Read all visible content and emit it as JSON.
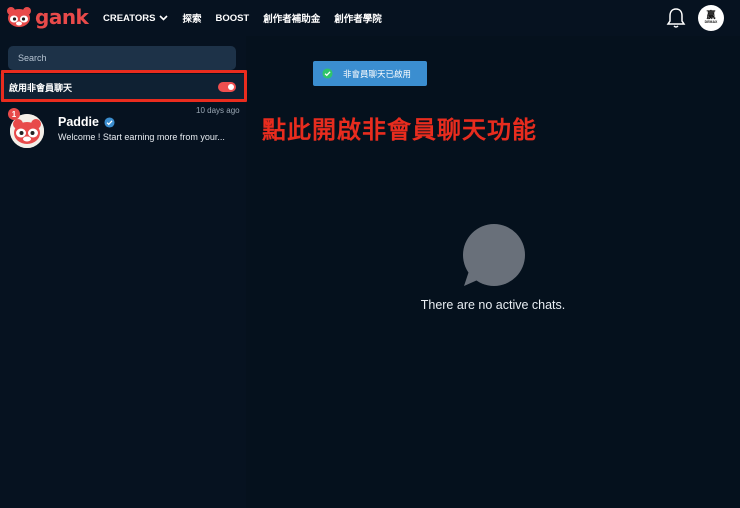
{
  "header": {
    "logo_text": "gank",
    "nav": [
      {
        "label": "CREATORS",
        "has_dropdown": true
      },
      {
        "label": "探索"
      },
      {
        "label": "BOOST"
      },
      {
        "label": "創作者補助金"
      },
      {
        "label": "創作者學院"
      }
    ],
    "avatar_text": "赢",
    "avatar_subtext": "DEMAX"
  },
  "sidebar": {
    "search_placeholder": "Search",
    "toggle_label": "啟用非會員聊天",
    "toggle_on": true,
    "chats": [
      {
        "name": "Paddie",
        "verified": true,
        "unread": "1",
        "time": "10 days ago",
        "preview": "Welcome ! Start earning more from your..."
      }
    ]
  },
  "main": {
    "toast_text": "非會員聊天已啟用",
    "annotation_text": "點此開啟非會員聊天功能",
    "empty_state_text": "There are no active chats."
  },
  "colors": {
    "background": "#05111d",
    "brand": "#e84a4a",
    "toast": "#3b8ed0",
    "annotation": "#e82c1e",
    "verified": "#3b8ed0"
  },
  "icons": [
    "red-panda-logo-icon",
    "chevron-down-icon",
    "bell-icon",
    "check-circle-icon",
    "verified-badge-icon",
    "chat-bubble-icon"
  ]
}
